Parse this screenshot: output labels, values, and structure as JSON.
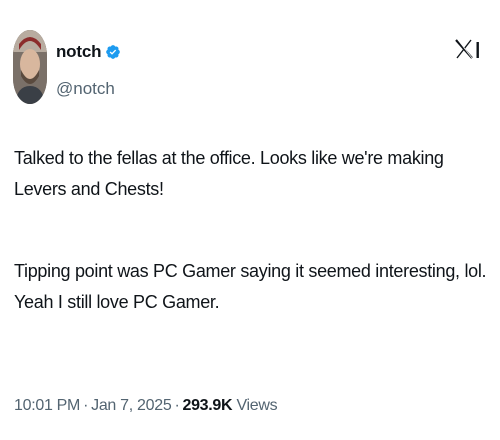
{
  "author": {
    "display_name": "notch",
    "handle": "@notch",
    "verified": true
  },
  "tweet": {
    "paragraphs": [
      "Talked to the fellas at the office.  Looks like we're making Levers and Chests!",
      "Tipping point was PC Gamer saying it seemed interesting, lol. Yeah I still love PC Gamer."
    ],
    "time": "10:01 PM",
    "separator": "·",
    "date": "Jan 7, 2025",
    "views_count": "293.9K",
    "views_label": "Views"
  },
  "icons": {
    "verified": "verified-badge-icon",
    "platform": "x-logo-icon",
    "more": "more-options-icon"
  },
  "colors": {
    "text": "#0f1419",
    "secondary": "#536471",
    "verified": "#1d9bf0"
  }
}
